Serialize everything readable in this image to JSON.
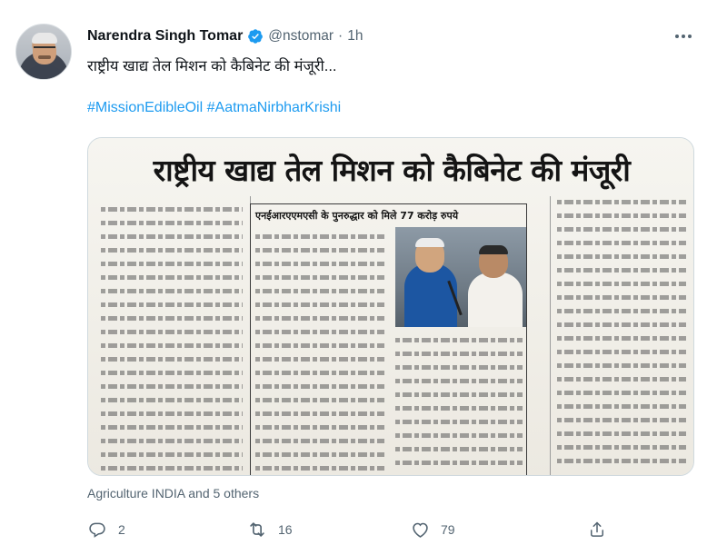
{
  "author": {
    "name": "Narendra Singh Tomar",
    "handle": "@nstomar",
    "separator": "·",
    "time": "1h"
  },
  "tweet": {
    "text": "राष्ट्रीय खाद्य तेल मिशन को कैबिनेट की मंजूरी...",
    "hashtags": [
      "#MissionEdibleOil",
      "#AatmaNirbharKrishi"
    ]
  },
  "media": {
    "headline": "राष्ट्रीय खाद्य तेल मिशन को कैबिनेट की मंजूरी",
    "subheadline": "एनईआरएएमएसी के पुनरुद्धार को मिले 77 करोड़ रुपये"
  },
  "social_context": "Agriculture INDIA and 5 others",
  "actions": {
    "reply_count": "2",
    "retweet_count": "16",
    "like_count": "79"
  },
  "colors": {
    "link": "#1d9bf0",
    "secondary_text": "#536471",
    "primary_text": "#0f1419",
    "border": "#cfd9de"
  },
  "icons": [
    "verified-badge-icon",
    "more-icon",
    "reply-icon",
    "retweet-icon",
    "like-icon",
    "share-icon"
  ]
}
